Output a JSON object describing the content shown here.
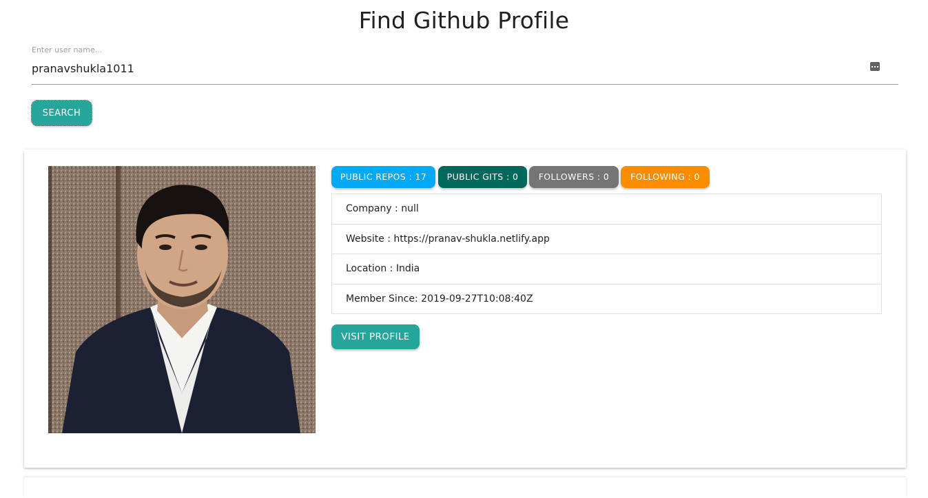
{
  "header": {
    "title": "Find Github Profile"
  },
  "search": {
    "label": "Enter user name...",
    "value": "pranavshukla1011",
    "button_label": "SEARCH",
    "field_icon": "autofill-icon"
  },
  "profile": {
    "avatar_alt": "profile photo",
    "stats": {
      "repos": "PUBLIC REPOS : 17",
      "gists": "PUBLIC GITS : 0",
      "followers": "FOLLOWERS : 0",
      "following": "FOLLOWING : 0"
    },
    "details": {
      "company": "Company : null",
      "website": "Website : https://pranav-shukla.netlify.app",
      "location": "Location : India",
      "member_since": "Member Since: 2019-09-27T10:08:40Z"
    },
    "visit_button": "VISIT PROFILE"
  },
  "colors": {
    "teal": "#26a69a",
    "repos_badge": "#03a9f4",
    "gists_badge": "#00695c",
    "followers_badge": "#757575",
    "following_badge": "#fb8c00"
  }
}
